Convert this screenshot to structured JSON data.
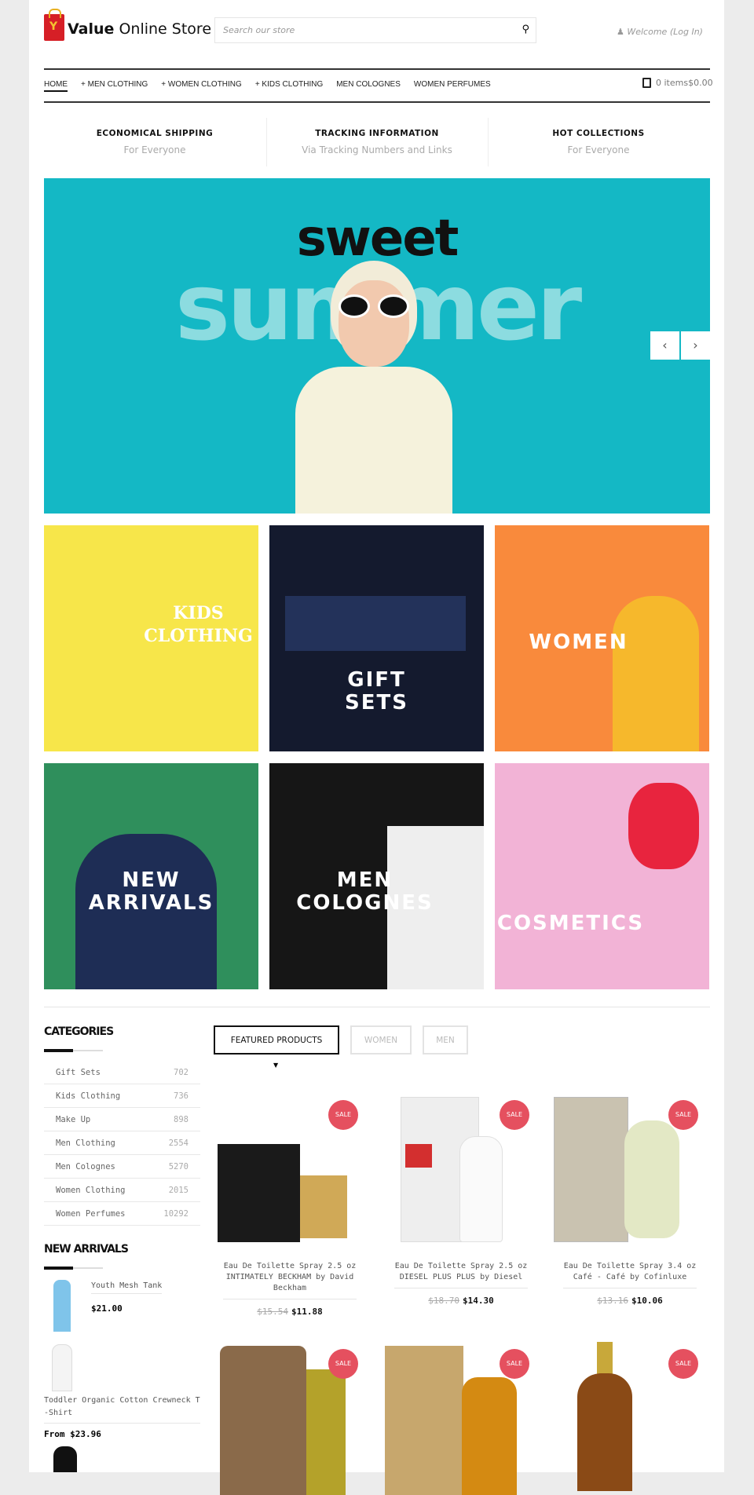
{
  "header": {
    "brand_bold": "Value",
    "brand_rest": " Online Store",
    "search_placeholder": "Search our store",
    "welcome": "Welcome (Log In)"
  },
  "nav": {
    "items": [
      "HOME",
      "+ MEN CLOTHING",
      "+ WOMEN CLOTHING",
      "+ KIDS CLOTHING",
      "MEN COLOGNES",
      "WOMEN PERFUMES"
    ],
    "cart": "0 items$0.00"
  },
  "features": [
    {
      "title": "ECONOMICAL SHIPPING",
      "subtitle": "For Everyone"
    },
    {
      "title": "TRACKING INFORMATION",
      "subtitle": "Via Tracking Numbers and Links"
    },
    {
      "title": "HOT COLLECTIONS",
      "subtitle": "For Everyone"
    }
  ],
  "banner": {
    "line1": "sweet",
    "line2": "summer",
    "prev": "‹",
    "next": "›",
    "color": "#14b8c5"
  },
  "tiles": [
    {
      "l1": "KIDS",
      "l2": "CLOTHING",
      "bg": "#f7e64a"
    },
    {
      "l1": "GIFT",
      "l2": "SETS",
      "bg": "#141a2e"
    },
    {
      "l1": "WOMEN",
      "l2": "",
      "bg": "#f98a3c"
    },
    {
      "l1": "NEW",
      "l2": "ARRIVALS",
      "bg": "#2f8f5c"
    },
    {
      "l1": "MEN",
      "l2": "COLOGNES",
      "bg": "#161616"
    },
    {
      "l1": "COSMETICS",
      "l2": "",
      "bg": "#f2b3d6"
    }
  ],
  "sidebar": {
    "categories_title": "CATEGORIES",
    "categories": [
      {
        "name": "Gift Sets",
        "count": "702"
      },
      {
        "name": "Kids Clothing",
        "count": "736"
      },
      {
        "name": "Make Up",
        "count": "898"
      },
      {
        "name": "Men Clothing",
        "count": "2554"
      },
      {
        "name": "Men Colognes",
        "count": "5270"
      },
      {
        "name": "Women Clothing",
        "count": "2015"
      },
      {
        "name": "Women Perfumes",
        "count": "10292"
      }
    ],
    "new_title": "NEW ARRIVALS",
    "new_items": [
      {
        "name": "Youth Mesh Tank",
        "price": "$21.00"
      },
      {
        "name": "Toddler Organic Cotton Crewneck T-Shirt",
        "price": "From $23.96"
      }
    ]
  },
  "tabs": [
    "FEATURED PRODUCTS",
    "WOMEN",
    "MEN"
  ],
  "products": [
    {
      "title": "Eau De Toilette Spray 2.5 oz INTIMATELY BECKHAM by David Beckham",
      "old": "$15.54",
      "price": "$11.88",
      "badge": "SALE"
    },
    {
      "title": "Eau De Toilette Spray 2.5 oz DIESEL PLUS PLUS by Diesel",
      "old": "$18.70",
      "price": "$14.30",
      "badge": "SALE"
    },
    {
      "title": "Eau De Toilette Spray 3.4 oz Café - Café by Cofinluxe",
      "old": "$13.16",
      "price": "$10.06",
      "badge": "SALE"
    },
    {
      "badge": "SALE"
    },
    {
      "badge": "SALE"
    },
    {
      "badge": "SALE"
    }
  ]
}
